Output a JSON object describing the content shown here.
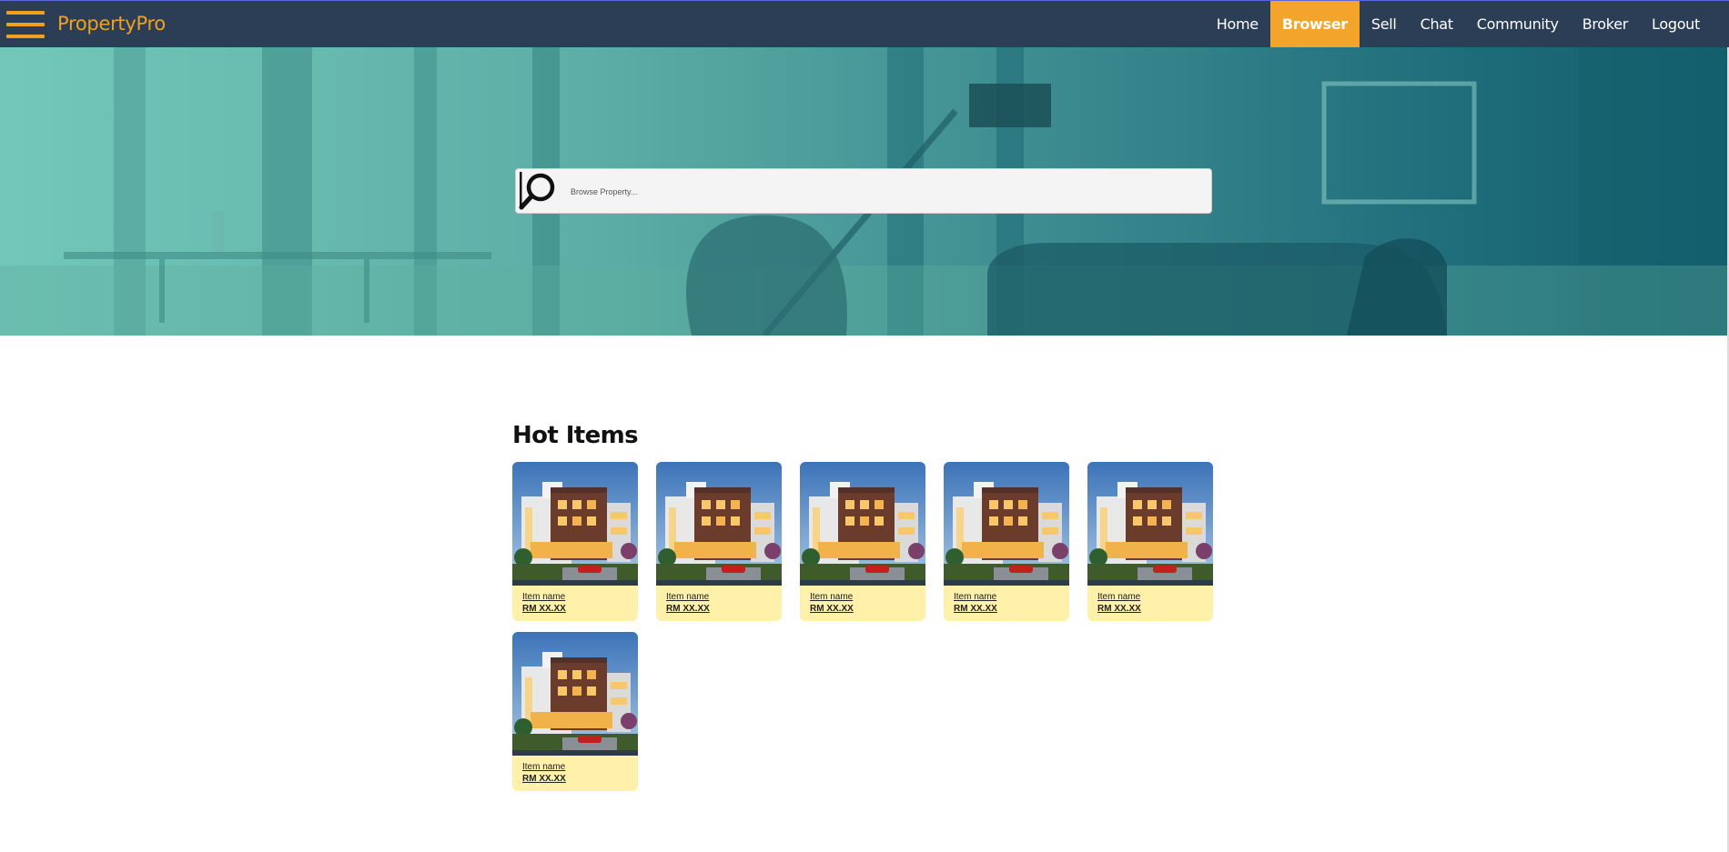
{
  "app": {
    "brand": "PropertyPro",
    "accent_color": "#f0a21e",
    "navbar_color": "#2c3e55",
    "menu_icon": "hamburger-menu-icon"
  },
  "nav": {
    "items": [
      {
        "label": "Home",
        "active": false
      },
      {
        "label": "Browser",
        "active": true
      },
      {
        "label": "Sell",
        "active": false
      },
      {
        "label": "Chat",
        "active": false
      },
      {
        "label": "Community",
        "active": false
      },
      {
        "label": "Broker",
        "active": false
      },
      {
        "label": "Logout",
        "active": false
      }
    ]
  },
  "search": {
    "placeholder": "Browse Property...",
    "value": "",
    "icon": "magnifier-search-icon"
  },
  "hot_items": {
    "title": "Hot Items",
    "card_color": "#fff1aa",
    "items": [
      {
        "name": "Item name",
        "price": "RM XX.XX"
      },
      {
        "name": "Item name",
        "price": "RM XX.XX"
      },
      {
        "name": "Item name",
        "price": "RM XX.XX"
      },
      {
        "name": "Item name",
        "price": "RM XX.XX"
      },
      {
        "name": "Item name",
        "price": "RM XX.XX"
      },
      {
        "name": "Item name",
        "price": "RM XX.XX"
      }
    ]
  }
}
